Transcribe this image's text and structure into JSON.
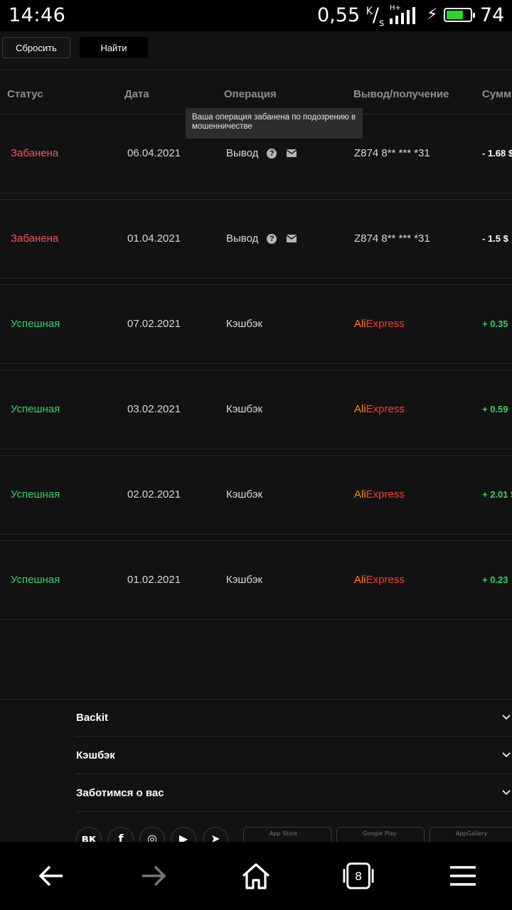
{
  "statusbar": {
    "time": "14:46",
    "speed": "0,55",
    "speed_unit_top": "K",
    "speed_unit_bottom": "s",
    "network": "H+",
    "battery_level": "74",
    "battery_fraction": 0.74
  },
  "filters": {
    "reset_label": "Сбросить",
    "find_label": "Найти"
  },
  "table": {
    "headers": {
      "status": "Статус",
      "date": "Дата",
      "operation": "Операция",
      "destination": "Вывод/получение",
      "sum": "Сумм"
    },
    "tooltip": "Ваша операция забанена по подозрению в мошенничестве",
    "rows": [
      {
        "status": "Забанена",
        "date": "06.04.2021",
        "operation": "Вывод",
        "destination": "Z874 8** *** *31",
        "sum": "- 1.68 $"
      },
      {
        "status": "Забанена",
        "date": "01.04.2021",
        "operation": "Вывод",
        "destination": "Z874 8** *** *31",
        "sum": "- 1.5 $"
      },
      {
        "status": "Успешная",
        "date": "07.02.2021",
        "operation": "Кэшбэк",
        "destination_a": "Ali",
        "destination_b": "Express",
        "sum": "+ 0.35"
      },
      {
        "status": "Успешная",
        "date": "03.02.2021",
        "operation": "Кэшбэк",
        "destination_a": "Ali",
        "destination_b": "Express",
        "sum": "+ 0.59"
      },
      {
        "status": "Успешная",
        "date": "02.02.2021",
        "operation": "Кэшбэк",
        "destination_a": "Ali",
        "destination_b": "Express",
        "sum": "+ 2.01 $"
      },
      {
        "status": "Успешная",
        "date": "01.02.2021",
        "operation": "Кэшбэк",
        "destination_a": "Ali",
        "destination_b": "Express",
        "sum": "+ 0.23"
      }
    ]
  },
  "footer": {
    "sections": [
      "Backit",
      "Кэшбэк",
      "Заботимся о вас"
    ],
    "socials": [
      "vk-icon",
      "facebook-icon",
      "instagram-icon",
      "youtube-icon",
      "telegram-icon"
    ],
    "stores": [
      "App Store",
      "Google Play",
      "AppGallery"
    ]
  },
  "navbar": {
    "tabs_count": "8"
  },
  "colors": {
    "banned": "#ff4f5e",
    "success": "#2fd46a",
    "background": "#121212"
  }
}
